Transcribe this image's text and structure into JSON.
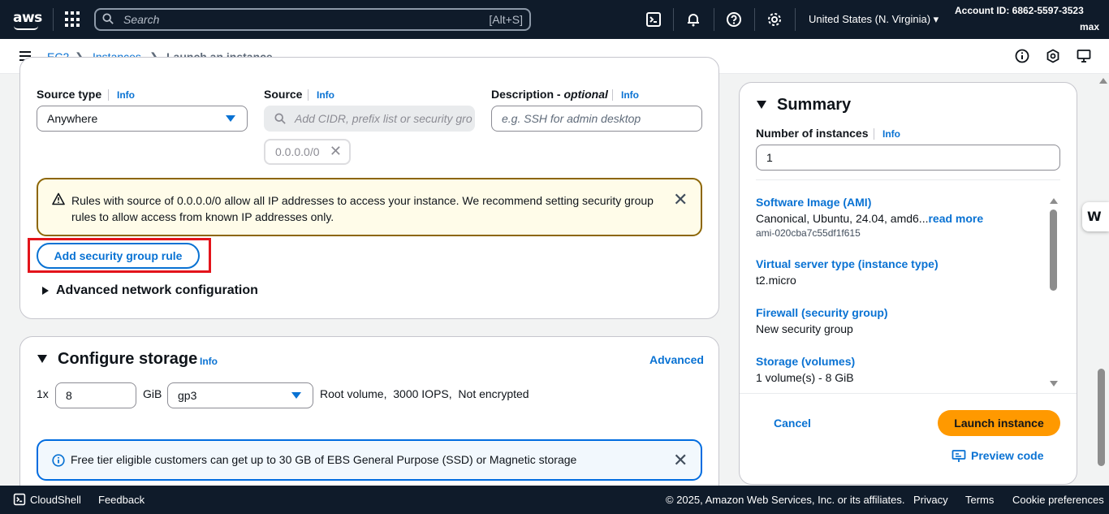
{
  "topbar": {
    "logo": "aws",
    "search_placeholder": "Search",
    "search_shortcut": "[Alt+S]",
    "region": "United States (N. Virginia)",
    "account": "Account ID: 6862-5597-3523",
    "user": "max",
    "icons": [
      "services-grid-icon",
      "search-icon",
      "cloudshell-icon",
      "bell-icon",
      "help-icon",
      "gear-icon"
    ]
  },
  "breadcrumb": {
    "items": [
      "EC2",
      "Instances",
      "Launch an instance"
    ]
  },
  "network": {
    "source_type_label": "Source type",
    "source_label": "Source",
    "description_label": "Description - ",
    "description_optional": "optional",
    "info": "Info",
    "source_type_value": "Anywhere",
    "source_placeholder": "Add CIDR, prefix list or security gro",
    "description_placeholder": "e.g. SSH for admin desktop",
    "token": "0.0.0.0/0",
    "warning": "Rules with source of 0.0.0.0/0 allow all IP addresses to access your instance. We recommend setting security group rules to allow access from known IP addresses only.",
    "add_rule": "Add security group rule",
    "advanced_network": "Advanced network configuration"
  },
  "storage": {
    "title": "Configure storage",
    "info": "Info",
    "advanced": "Advanced",
    "count_prefix": "1x",
    "size": "8",
    "unit": "GiB",
    "volume_type": "gp3",
    "details": "Root volume,  3000 IOPS,  Not encrypted",
    "free_tier_info": "Free tier eligible customers can get up to 30 GB of EBS General Purpose (SSD) or Magnetic storage"
  },
  "summary": {
    "title": "Summary",
    "num_instances_label": "Number of instances",
    "info": "Info",
    "num_instances": "1",
    "ami_label": "Software Image (AMI)",
    "ami_value": "Canonical, Ubuntu, 24.04, amd6...",
    "read_more": "read more",
    "ami_id": "ami-020cba7c55df1f615",
    "instance_type_label": "Virtual server type (instance type)",
    "instance_type": "t2.micro",
    "firewall_label": "Firewall (security group)",
    "firewall": "New security group",
    "storage_label": "Storage (volumes)",
    "storage": "1 volume(s) - 8 GiB",
    "cancel": "Cancel",
    "launch": "Launch instance",
    "preview": "Preview code"
  },
  "footer": {
    "cloudshell": "CloudShell",
    "feedback": "Feedback",
    "copyright": "© 2025, Amazon Web Services, Inc. or its affiliates.",
    "privacy": "Privacy",
    "terms": "Terms",
    "cookies": "Cookie preferences"
  },
  "colors": {
    "topbar": "#0f1b2a",
    "link": "#0972d3",
    "launch": "#ff9900",
    "warning_border": "#8d6605",
    "highlight": "#e3141b"
  }
}
